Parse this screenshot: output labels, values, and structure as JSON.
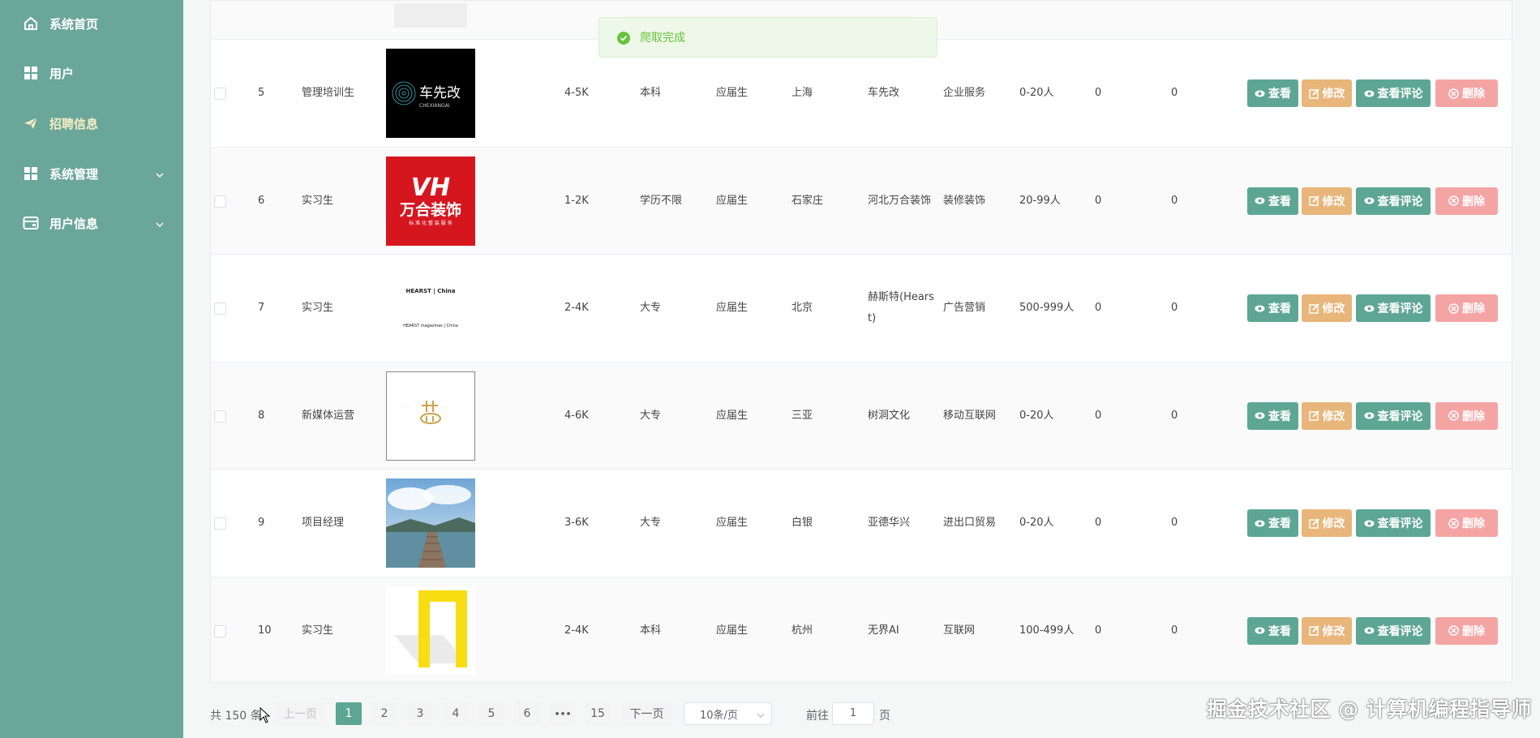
{
  "sidebar": {
    "items": [
      {
        "label": "系统首页",
        "icon": "home-icon"
      },
      {
        "label": "用户",
        "icon": "grid-icon"
      },
      {
        "label": "招聘信息",
        "icon": "paper-plane-icon"
      },
      {
        "label": "系统管理",
        "icon": "grid-icon"
      },
      {
        "label": "用户信息",
        "icon": "card-icon"
      }
    ]
  },
  "toast": {
    "message": "爬取完成"
  },
  "rows": [
    {
      "index": "5",
      "title": "管理培训生",
      "salary": "4-5K",
      "education": "本科",
      "experience": "应届生",
      "city": "上海",
      "company": "车先改",
      "industry": "企业服务",
      "size": "0-20人",
      "c1": "0",
      "c2": "0",
      "logo_text": "车先改",
      "logo_sub": "CHEXIANGAI"
    },
    {
      "index": "6",
      "title": "实习生",
      "salary": "1-2K",
      "education": "学历不限",
      "experience": "应届生",
      "city": "石家庄",
      "company": "河北万合装饰",
      "industry": "装修装饰",
      "size": "20-99人",
      "c1": "0",
      "c2": "0",
      "logo_text": "万合装饰",
      "logo_sub": "VH"
    },
    {
      "index": "7",
      "title": "实习生",
      "salary": "2-4K",
      "education": "大专",
      "experience": "应届生",
      "city": "北京",
      "company": "赫斯特(Hearst)",
      "industry": "广告营销",
      "size": "500-999人",
      "c1": "0",
      "c2": "0",
      "logo_text": "HEARST | China",
      "logo_sub": "HEARST magazines | China"
    },
    {
      "index": "8",
      "title": "新媒体运营",
      "salary": "4-6K",
      "education": "大专",
      "experience": "应届生",
      "city": "三亚",
      "company": "树洞文化",
      "industry": "移动互联网",
      "size": "0-20人",
      "c1": "0",
      "c2": "0",
      "logo_text": "",
      "logo_sub": ""
    },
    {
      "index": "9",
      "title": "项目经理",
      "salary": "3-6K",
      "education": "大专",
      "experience": "应届生",
      "city": "白银",
      "company": "亚德华兴",
      "industry": "进出口贸易",
      "size": "0-20人",
      "c1": "0",
      "c2": "0",
      "logo_text": "",
      "logo_sub": ""
    },
    {
      "index": "10",
      "title": "实习生",
      "salary": "2-4K",
      "education": "本科",
      "experience": "应届生",
      "city": "杭州",
      "company": "无界AI",
      "industry": "互联网",
      "size": "100-499人",
      "c1": "0",
      "c2": "0",
      "logo_text": "",
      "logo_sub": ""
    }
  ],
  "actions": {
    "view": "查看",
    "edit": "修改",
    "comments": "查看评论",
    "delete": "删除"
  },
  "pagination": {
    "total": "共 150 条",
    "prev": "上一页",
    "pages": [
      "1",
      "2",
      "3",
      "4",
      "5",
      "6",
      "•••",
      "15"
    ],
    "next": "下一页",
    "page_size": "10条/页",
    "goto_label": "前往",
    "goto_value": "1",
    "page_suffix": "页",
    "current_page": 1
  },
  "watermark": "掘金技术社区 @ 计算机编程指导师",
  "colors": {
    "sidebar": "#6aa79a",
    "primary": "#5ea694",
    "warning": "#e8b57a",
    "danger": "#f5a4a4",
    "active_menu": "#f5ecc4"
  }
}
